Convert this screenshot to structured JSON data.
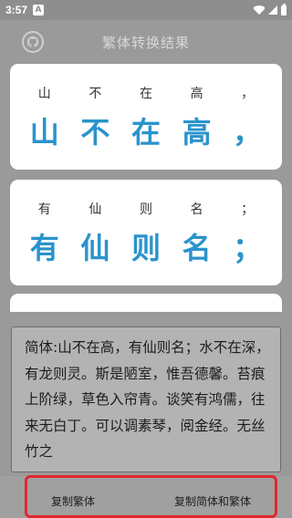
{
  "status_bar": {
    "time": "3:57",
    "notif_letter": "A"
  },
  "header": {
    "title": "繁体转换结果"
  },
  "cards": [
    {
      "pinyin": [
        "山",
        "不",
        "在",
        "高",
        "，"
      ],
      "chars": [
        "山",
        "不",
        "在",
        "高",
        "，"
      ]
    },
    {
      "pinyin": [
        "有",
        "仙",
        "则",
        "名",
        "；"
      ],
      "chars": [
        "有",
        "仙",
        "则",
        "名",
        "；"
      ]
    }
  ],
  "text_panel": {
    "content": "简体:山不在高，有仙则名；水不在深，有龙则灵。斯是陋室，惟吾德馨。苔痕上阶绿，草色入帘青。谈笑有鸿儒，往来无白丁。可以调素琴，阅金经。无丝竹之"
  },
  "actions": {
    "copy_traditional": "复制繁体",
    "copy_both": "复制简体和繁体"
  },
  "colors": {
    "accent": "#2a93cc",
    "highlight": "#e3262b"
  }
}
